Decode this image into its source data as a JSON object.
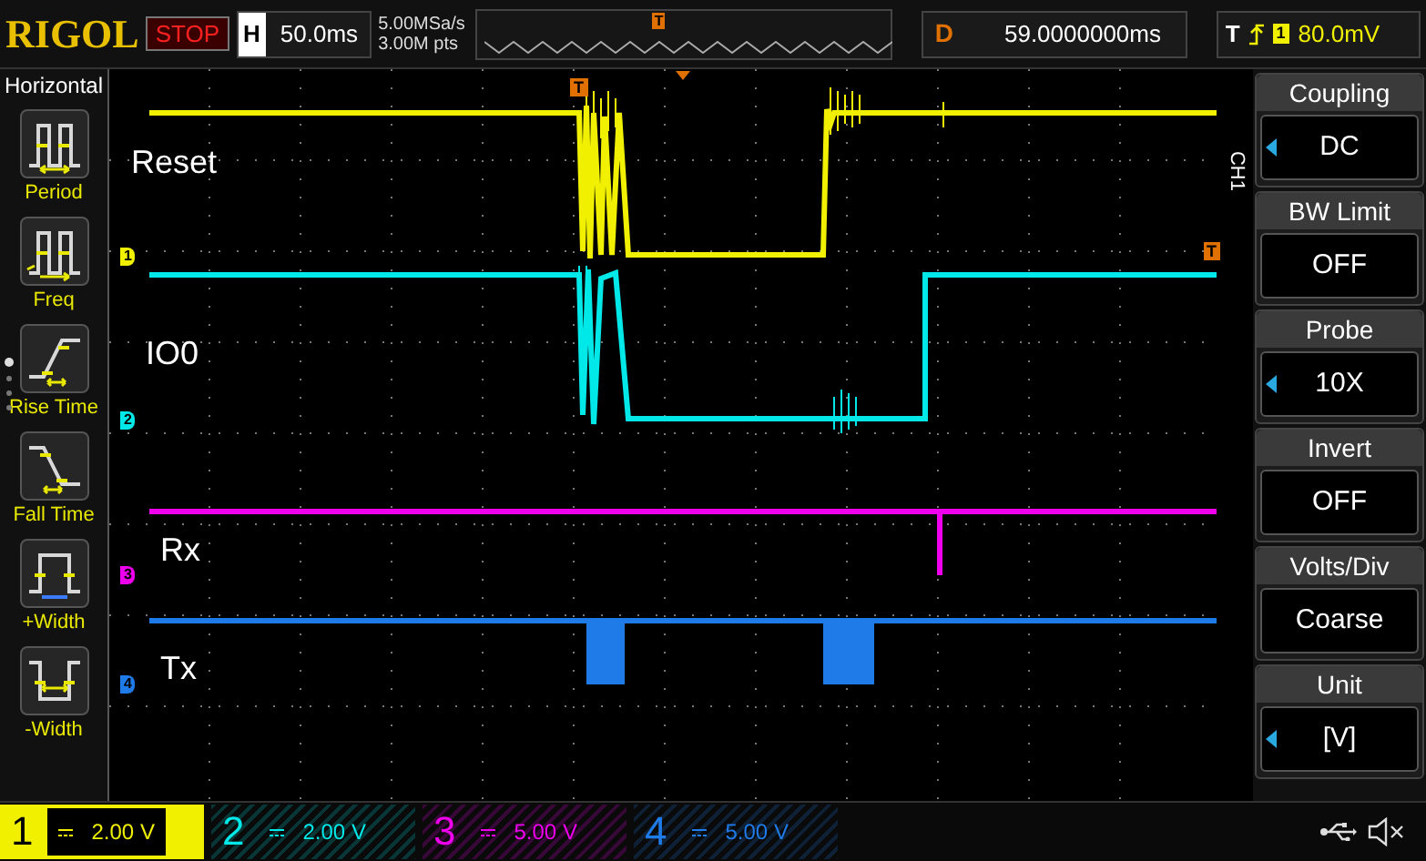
{
  "brand": "RIGOL",
  "run_state": "STOP",
  "horizontal": {
    "label": "H",
    "timebase": "50.0ms"
  },
  "acquisition": {
    "sample_rate": "5.00MSa/s",
    "memory_depth": "3.00M pts"
  },
  "overview": {
    "trigger_marker": "T"
  },
  "delay": {
    "label": "D",
    "value": "59.0000000ms"
  },
  "trigger": {
    "label": "T",
    "source": "1",
    "level": "80.0mV"
  },
  "measure_menu": {
    "title": "Horizontal",
    "items": [
      {
        "label": "Period",
        "kind": "period"
      },
      {
        "label": "Freq",
        "kind": "freq"
      },
      {
        "label": "Rise Time",
        "kind": "rise"
      },
      {
        "label": "Fall Time",
        "kind": "fall"
      },
      {
        "label": "+Width",
        "kind": "pwidth"
      },
      {
        "label": "-Width",
        "kind": "nwidth"
      }
    ]
  },
  "screen": {
    "trigger_marker": "T",
    "trigger_level_marker": "T",
    "traces": [
      {
        "channel": "1",
        "name": "Reset",
        "color": "#f0f000"
      },
      {
        "channel": "2",
        "name": "IO0",
        "color": "#00e8e8"
      },
      {
        "channel": "3",
        "name": "Rx",
        "color": "#ee00ee"
      },
      {
        "channel": "4",
        "name": "Tx",
        "color": "#1e7be8"
      }
    ]
  },
  "channel_menu": {
    "channel": "CH1",
    "items": [
      {
        "title": "Coupling",
        "value": "DC",
        "adjustable": true
      },
      {
        "title": "BW Limit",
        "value": "OFF",
        "adjustable": false
      },
      {
        "title": "Probe",
        "value": "10X",
        "adjustable": true
      },
      {
        "title": "Invert",
        "value": "OFF",
        "adjustable": false
      },
      {
        "title": "Volts/Div",
        "value": "Coarse",
        "adjustable": false
      },
      {
        "title": "Unit",
        "value": "[V]",
        "adjustable": true
      }
    ]
  },
  "channels": [
    {
      "number": "1",
      "scale": "2.00 V",
      "selected": true,
      "color": "#f0f000"
    },
    {
      "number": "2",
      "scale": "2.00 V",
      "selected": false,
      "color": "#00e8e8"
    },
    {
      "number": "3",
      "scale": "5.00 V",
      "selected": false,
      "color": "#ee00ee"
    },
    {
      "number": "4",
      "scale": "5.00 V",
      "selected": false,
      "color": "#1e7be8"
    }
  ]
}
